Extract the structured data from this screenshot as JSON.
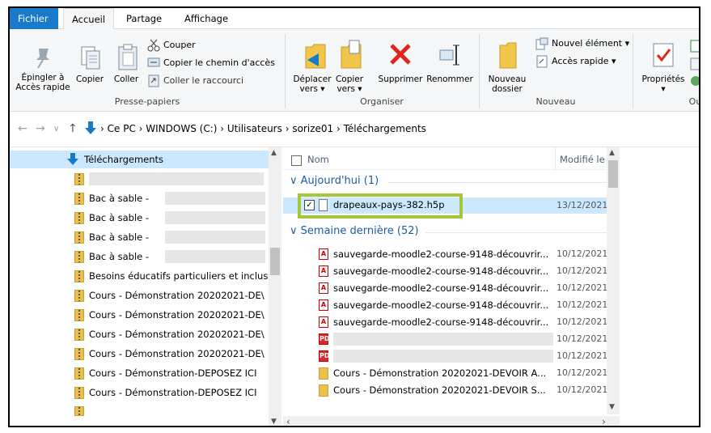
{
  "ribbon_tabs": [
    "Fichier",
    "Accueil",
    "Partage",
    "Affichage"
  ],
  "clipboard": {
    "pin_label_1": "Épingler à",
    "pin_label_2": "Accès rapide",
    "copy_label": "Copier",
    "paste_label": "Coller",
    "cut_label": "Couper",
    "copy_path_label": "Copier le chemin d'accès",
    "paste_shortcut_label": "Coller le raccourci",
    "group_label": "Presse-papiers"
  },
  "organize": {
    "move_label_1": "Déplacer",
    "move_label_2": "vers ▾",
    "copyto_label_1": "Copier",
    "copyto_label_2": "vers ▾",
    "delete_label": "Supprimer",
    "rename_label": "Renommer",
    "group_label": "Organiser"
  },
  "new": {
    "new_folder_1": "Nouveau",
    "new_folder_2": "dossier",
    "new_item": "Nouvel élément ▾",
    "quick_access": "Accès rapide ▾",
    "group_label": "Nouveau"
  },
  "open": {
    "properties_label": "Propriétés",
    "group_label": "Ouvr"
  },
  "address": {
    "crumbs": [
      "Ce PC",
      "WINDOWS (C:)",
      "Utilisateurs",
      "sorize01",
      "Téléchargements"
    ]
  },
  "tree": {
    "header": "Téléchargements",
    "items": [
      "",
      "Bac à sable - ",
      "Bac à sable - ",
      "Bac à sable - ",
      "Bac à sable - ",
      "Besoins éducatifs particuliers et inclus",
      "Cours - Démonstration  20202021-DE\\",
      "Cours - Démonstration  20202021-DE\\",
      "Cours - Démonstration  20202021-DE\\",
      "Cours - Démonstration  20202021-DE\\",
      "Cours - Démonstration-DEPOSEZ ICI",
      "Cours - Démonstration-DEPOSEZ ICI"
    ]
  },
  "files": {
    "col_name": "Nom",
    "col_modified": "Modifié le",
    "group_today": "Aujourd'hui (1)",
    "selected_file": "drapeaux-pays-382.h5p",
    "selected_date": "13/12/2021",
    "group_last_week": "Semaine dernière (52)",
    "rows": [
      {
        "name": "sauvegarde-moodle2-course-9148-découvrir...",
        "date": "10/12/2021"
      },
      {
        "name": "sauvegarde-moodle2-course-9148-découvrir...",
        "date": "10/12/2021"
      },
      {
        "name": "sauvegarde-moodle2-course-9148-découvrir...",
        "date": "10/12/2021"
      },
      {
        "name": "sauvegarde-moodle2-course-9148-découvrir...",
        "date": "10/12/2021"
      },
      {
        "name": "sauvegarde-moodle2-course-9148-découvrir...",
        "date": "10/12/2021"
      },
      {
        "name": "",
        "date": "10/12/2021"
      },
      {
        "name": "",
        "date": "10/12/2021"
      },
      {
        "name": "Cours - Démonstration  20202021-DEVOIR A...",
        "date": "10/12/2021"
      },
      {
        "name": "Cours - Démonstration  20202021-DEVOIR S...",
        "date": "10/12/2021"
      }
    ]
  },
  "colors": {
    "file_tab": "#1979ca",
    "highlight_box": "#a4c639",
    "selection": "#cce8ff",
    "group_header": "#1e5aa8"
  }
}
